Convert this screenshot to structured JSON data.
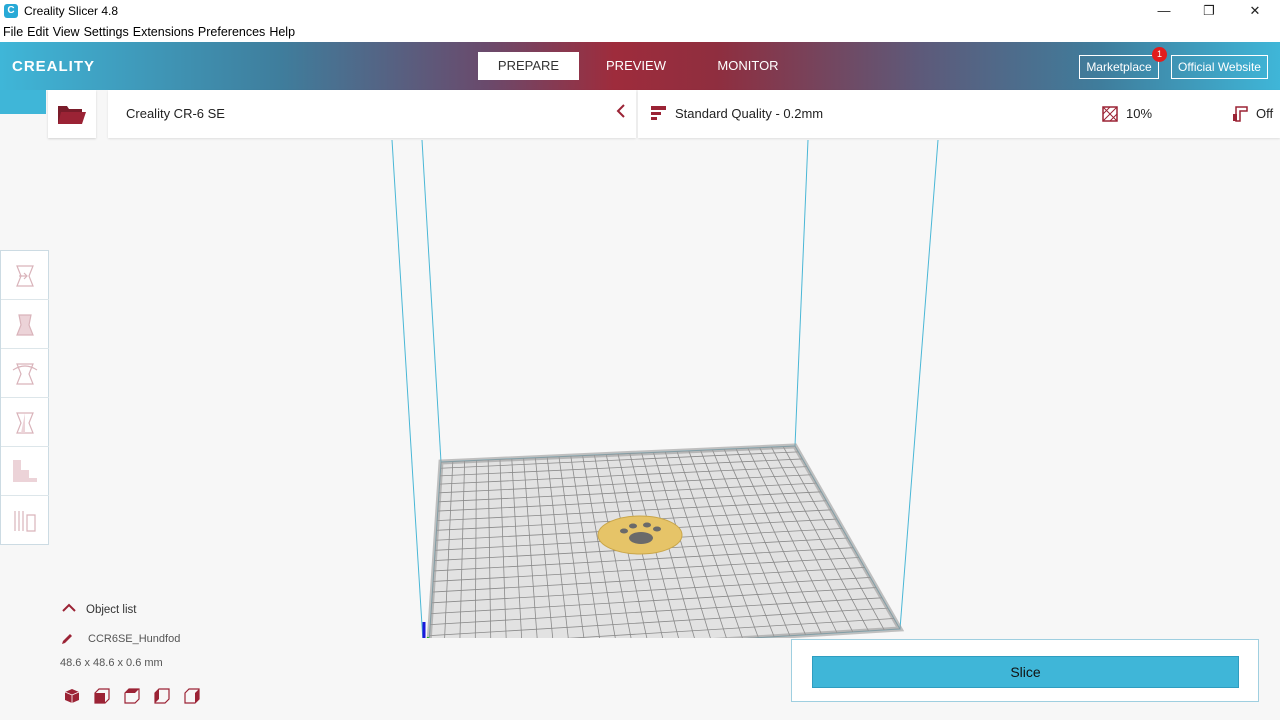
{
  "window": {
    "title": "Creality Slicer 4.8",
    "minimize": "—",
    "maximize": "❐",
    "close": "✕"
  },
  "menu": [
    "File",
    "Edit",
    "View",
    "Settings",
    "Extensions",
    "Preferences",
    "Help"
  ],
  "header": {
    "logo": "CREALITY",
    "tabs": [
      "PREPARE",
      "PREVIEW",
      "MONITOR"
    ],
    "active_tab": "PREPARE",
    "marketplace": "Marketplace",
    "marketplace_badge": "1",
    "official_website": "Official Website"
  },
  "printer": {
    "name": "Creality CR-6 SE"
  },
  "settings": {
    "quality": "Standard Quality - 0.2mm",
    "infill": "10%",
    "support": "Off"
  },
  "tools": [
    "move-tool-icon",
    "scale-tool-icon",
    "rotate-tool-icon",
    "mirror-tool-icon",
    "per-model-settings-icon",
    "support-blocker-icon"
  ],
  "object_list": {
    "label": "Object list",
    "object_name": "CCR6SE_Hundfod",
    "dimensions": "48.6 x 48.6 x 0.6 mm"
  },
  "slice": {
    "label": "Slice"
  },
  "colors": {
    "accent": "#9b2335",
    "cyan": "#3fb6d8",
    "object": "#e6c468"
  }
}
